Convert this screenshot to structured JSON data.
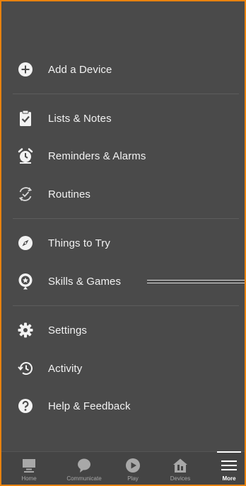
{
  "menu": {
    "items": [
      {
        "label": "Add a Device",
        "icon": "plus-circle-icon"
      },
      {
        "label": "Lists & Notes",
        "icon": "clipboard-check-icon"
      },
      {
        "label": "Reminders & Alarms",
        "icon": "alarm-clock-icon"
      },
      {
        "label": "Routines",
        "icon": "routine-check-icon"
      },
      {
        "label": "Things to Try",
        "icon": "compass-icon"
      },
      {
        "label": "Skills & Games",
        "icon": "skills-badge-icon"
      },
      {
        "label": "Settings",
        "icon": "gear-icon"
      },
      {
        "label": "Activity",
        "icon": "history-icon"
      },
      {
        "label": "Help & Feedback",
        "icon": "question-circle-icon"
      }
    ]
  },
  "bottom_nav": {
    "items": [
      {
        "label": "Home",
        "icon": "home-icon"
      },
      {
        "label": "Communicate",
        "icon": "chat-bubble-icon"
      },
      {
        "label": "Play",
        "icon": "play-icon"
      },
      {
        "label": "Devices",
        "icon": "devices-house-icon"
      },
      {
        "label": "More",
        "icon": "hamburger-menu-icon",
        "active": true
      }
    ]
  },
  "colors": {
    "background": "#4a4a4a",
    "border": "#e8820e",
    "text": "#f2f2f2",
    "nav_inactive": "#a8a8a8"
  }
}
